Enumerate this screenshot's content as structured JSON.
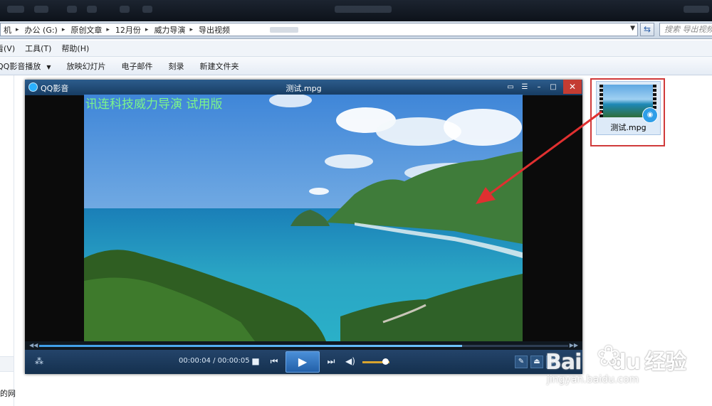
{
  "address_bar": {
    "crumbs": [
      "机",
      "办公 (G:)",
      "原创文章",
      "12月份",
      "威力导演",
      "导出视频"
    ],
    "search_placeholder": "搜索 导出视频"
  },
  "menu": {
    "items": [
      "看(V)",
      "工具(T)",
      "帮助(H)"
    ]
  },
  "toolbar": {
    "items": [
      "QQ影音播放",
      "放映幻灯片",
      "电子邮件",
      "刻录",
      "新建文件夹"
    ]
  },
  "nav_pane": {
    "partial_text": "的网"
  },
  "file_item": {
    "name": "测试.mpg",
    "highlight_color": "#d03a3a"
  },
  "player": {
    "app_name": "QQ影音",
    "file_title": "测试.mpg",
    "watermark": "讯连科技威力导演  试用版",
    "current_time": "00:00:04",
    "total_time": "00:00:05",
    "time_display": "00:00:04 / 00:00:05",
    "progress": 0.8,
    "volume": 0.85,
    "accent_color": "#3f9ee8",
    "icons": {
      "logo": "qq-player-logo-icon",
      "chat": "chat-bubble-icon",
      "list": "playlist-icon",
      "minimize": "minimize-icon",
      "maximize": "maximize-icon",
      "close": "close-icon",
      "stop": "stop-icon",
      "prev": "previous-icon",
      "play": "play-icon",
      "next": "next-icon",
      "volume": "volume-icon",
      "tools": "wrench-icon",
      "eject": "eject-icon"
    }
  },
  "watermark_site": {
    "brand_left": "Bai",
    "brand_right": "du",
    "brand_suffix": "经验",
    "url": "jingyan.baidu.com"
  }
}
